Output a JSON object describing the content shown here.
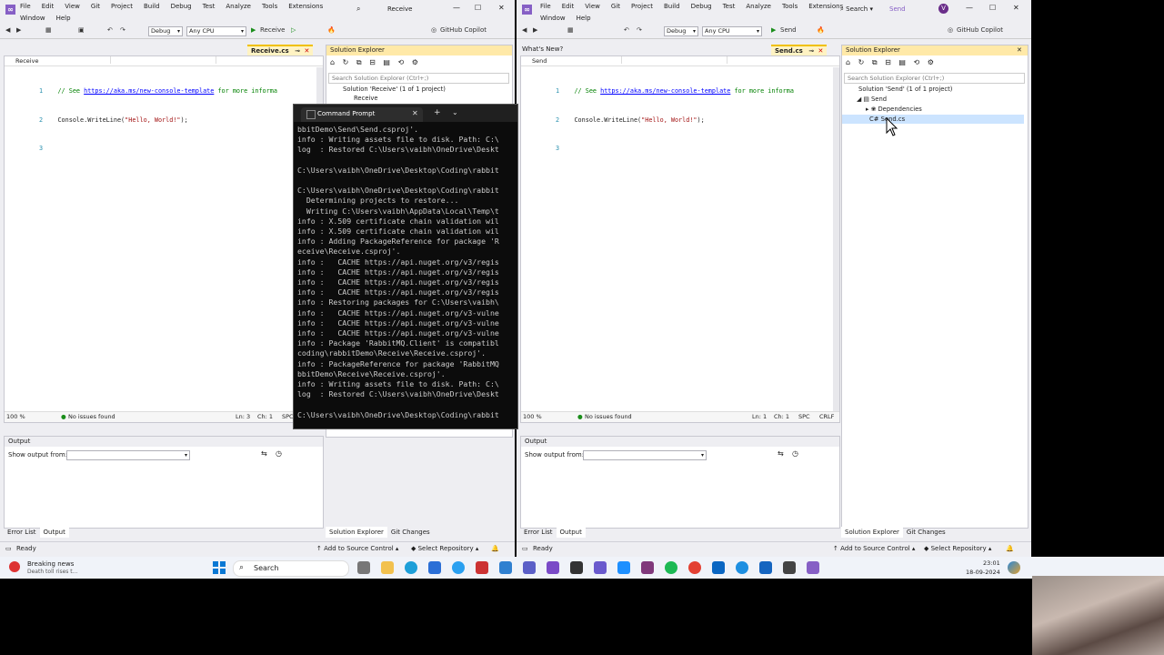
{
  "left_window": {
    "title": "Receive",
    "menu": [
      "File",
      "Edit",
      "View",
      "Git",
      "Project",
      "Build",
      "Debug",
      "Test",
      "Analyze",
      "Tools",
      "Extensions",
      "Window",
      "Help"
    ],
    "search_icon": "search-icon",
    "toolbar": {
      "config": "Debug",
      "platform": "Any CPU",
      "run_target": "Receive",
      "copilot": "GitHub Copilot"
    },
    "doc_tab": "Receive.cs",
    "nav_left": "Receive",
    "code": [
      {
        "ln": "1",
        "comment_pre": "// See ",
        "link": "https://aka.ms/new-console-template",
        "comment_post": " for more informa"
      },
      {
        "ln": "2",
        "code_pre": "Console.WriteLine(",
        "str": "\"Hello, World!\"",
        "code_post": ");"
      },
      {
        "ln": "3"
      }
    ],
    "editor_status": {
      "zoom": "100 %",
      "issues": "No issues found",
      "ln": "Ln: 3",
      "ch": "Ch: 1",
      "enc": "SPC"
    },
    "solution_explorer": {
      "title": "Solution Explorer",
      "search": "Search Solution Explorer (Ctrl+;)",
      "solution": "Solution 'Receive' (1 of 1 project)",
      "project": "Receive"
    },
    "output": {
      "title": "Output",
      "show_from": "Show output from:"
    },
    "bottom_tabs_left": [
      "Error List",
      "Output"
    ],
    "bottom_tabs_right": [
      "Solution Explorer",
      "Git Changes"
    ],
    "status": {
      "ready": "Ready",
      "source_control": "Add to Source Control",
      "repo": "Select Repository"
    }
  },
  "right_window": {
    "title": "Send",
    "search_label": "Search",
    "menu": [
      "File",
      "Edit",
      "View",
      "Git",
      "Project",
      "Build",
      "Debug",
      "Test",
      "Analyze",
      "Tools",
      "Extensions",
      "Window",
      "Help"
    ],
    "avatar": "V",
    "toolbar": {
      "config": "Debug",
      "platform": "Any CPU",
      "run_target": "Send",
      "copilot": "GitHub Copilot"
    },
    "whats_new": "What's New?",
    "doc_tab": "Send.cs",
    "nav_left": "Send",
    "code": [
      {
        "ln": "1",
        "comment_pre": "// See ",
        "link": "https://aka.ms/new-console-template",
        "comment_post": " for more informa"
      },
      {
        "ln": "2",
        "code_pre": "Console.WriteLine(",
        "str": "\"Hello, World!\"",
        "code_post": ");"
      },
      {
        "ln": "3"
      }
    ],
    "editor_status": {
      "zoom": "100 %",
      "issues": "No issues found",
      "ln": "Ln: 1",
      "ch": "Ch: 1",
      "enc": "SPC",
      "eol": "CRLF"
    },
    "solution_explorer": {
      "title": "Solution Explorer",
      "search": "Search Solution Explorer (Ctrl+;)",
      "solution": "Solution 'Send' (1 of 1 project)",
      "project": "Send",
      "dependencies": "Dependencies",
      "file": "Send.cs"
    },
    "output": {
      "title": "Output",
      "show_from": "Show output from:"
    },
    "bottom_tabs_left": [
      "Error List",
      "Output"
    ],
    "bottom_tabs_right": [
      "Solution Explorer",
      "Git Changes"
    ],
    "status": {
      "ready": "Ready",
      "source_control": "Add to Source Control",
      "repo": "Select Repository"
    }
  },
  "cmd": {
    "title": "Command Prompt",
    "lines": [
      "bbitDemo\\Send\\Send.csproj'.",
      "info : Writing assets file to disk. Path: C:\\",
      "log  : Restored C:\\Users\\vaibh\\OneDrive\\Deskt",
      "",
      "C:\\Users\\vaibh\\OneDrive\\Desktop\\Coding\\rabbit",
      "",
      "C:\\Users\\vaibh\\OneDrive\\Desktop\\Coding\\rabbit",
      "  Determining projects to restore...",
      "  Writing C:\\Users\\vaibh\\AppData\\Local\\Temp\\t",
      "info : X.509 certificate chain validation wil",
      "info : X.509 certificate chain validation wil",
      "info : Adding PackageReference for package 'R",
      "eceive\\Receive.csproj'.",
      "info :   CACHE https://api.nuget.org/v3/regis",
      "info :   CACHE https://api.nuget.org/v3/regis",
      "info :   CACHE https://api.nuget.org/v3/regis",
      "info :   CACHE https://api.nuget.org/v3/regis",
      "info : Restoring packages for C:\\Users\\vaibh\\",
      "info :   CACHE https://api.nuget.org/v3-vulne",
      "info :   CACHE https://api.nuget.org/v3-vulne",
      "info :   CACHE https://api.nuget.org/v3-vulne",
      "info : Package 'RabbitMQ.Client' is compatibl",
      "coding\\rabbitDemo\\Receive\\Receive.csproj'.",
      "info : PackageReference for package 'RabbitMQ",
      "bbitDemo\\Receive\\Receive.csproj'.",
      "info : Writing assets file to disk. Path: C:\\",
      "log  : Restored C:\\Users\\vaibh\\OneDrive\\Deskt",
      "",
      "C:\\Users\\vaibh\\OneDrive\\Desktop\\Coding\\rabbit"
    ]
  },
  "taskbar": {
    "news_title": "Breaking news",
    "news_sub": "Death toll rises t...",
    "search": "Search",
    "time": "23:01",
    "date": "18-09-2024"
  }
}
